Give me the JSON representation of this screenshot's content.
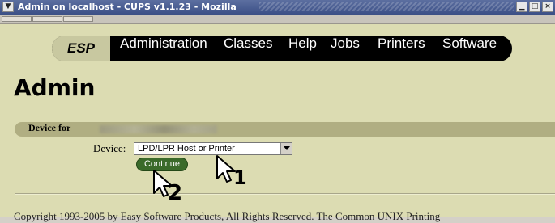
{
  "window": {
    "title": "Admin on localhost - CUPS v1.1.23 - Mozilla",
    "menu_glyph": "▼",
    "minimize_glyph": "▁",
    "maximize_glyph": "□",
    "close_glyph": "×"
  },
  "nav": {
    "brand": "ESP",
    "items": [
      "Administration",
      "Classes",
      "Help",
      "Jobs",
      "Printers",
      "Software"
    ]
  },
  "page": {
    "heading": "Admin",
    "section_label": "Device for",
    "device_label": "Device:",
    "device_value": "LPD/LPR Host or Printer",
    "continue_label": "Continue",
    "copyright": "Copyright 1993-2005 by Easy Software Products, All Rights Reserved. The Common UNIX Printing"
  },
  "callouts": [
    "1",
    "2"
  ],
  "colors": {
    "page_bg": "#dcdcb2",
    "nav_bg": "#000000",
    "brand_bg": "#c8c8a0",
    "section_bar": "#b0ae82",
    "continue_button": "#3a6a2a"
  }
}
